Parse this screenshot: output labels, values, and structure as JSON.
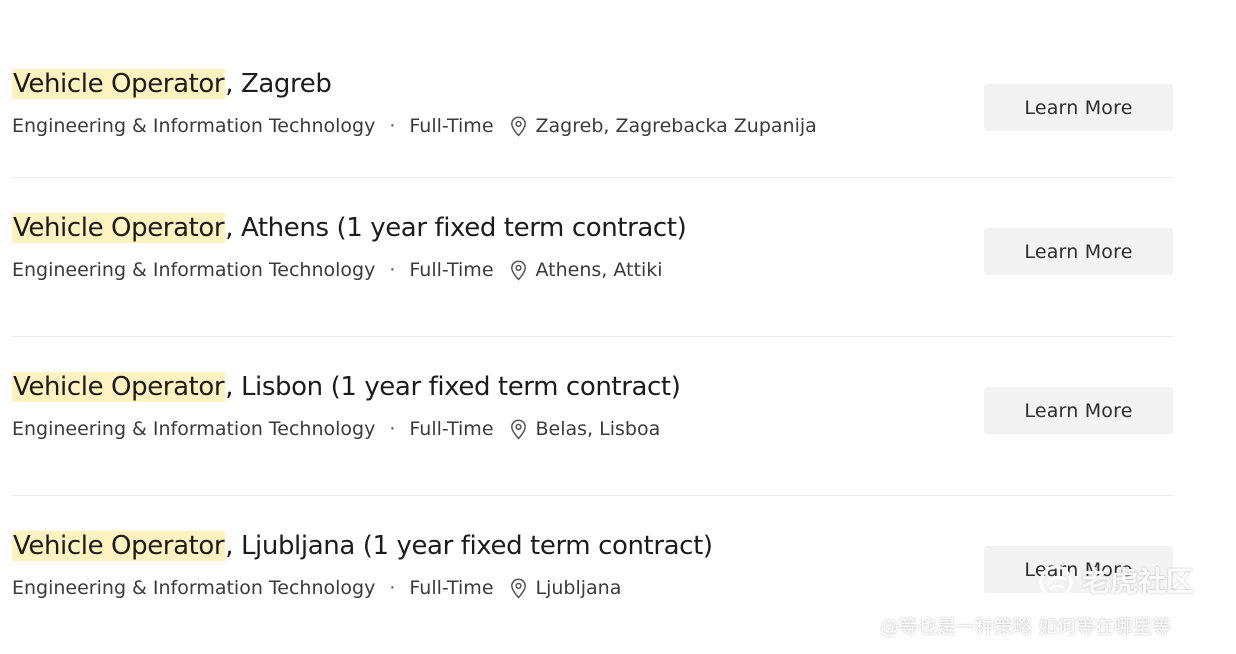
{
  "jobs": [
    {
      "title_highlight": "Vehicle Operator",
      "title_rest": ", Zagreb",
      "department": "Engineering & Information Technology",
      "separator": "·",
      "employment_type": "Full-Time",
      "location": "Zagreb, Zagrebacka Zupanija",
      "cta_label": "Learn More"
    },
    {
      "title_highlight": "Vehicle Operator",
      "title_rest": ", Athens (1 year fixed term contract)",
      "department": "Engineering & Information Technology",
      "separator": "·",
      "employment_type": "Full-Time",
      "location": "Athens, Attiki",
      "cta_label": "Learn More"
    },
    {
      "title_highlight": "Vehicle Operator",
      "title_rest": ", Lisbon (1 year fixed term contract)",
      "department": "Engineering & Information Technology",
      "separator": "·",
      "employment_type": "Full-Time",
      "location": "Belas, Lisboa",
      "cta_label": "Learn More"
    },
    {
      "title_highlight": "Vehicle Operator",
      "title_rest": ", Ljubljana (1 year fixed term contract)",
      "department": "Engineering & Information Technology",
      "separator": "·",
      "employment_type": "Full-Time",
      "location": "Ljubljana",
      "cta_label": "Learn More"
    }
  ],
  "icons": {
    "location": "map-pin-icon",
    "watermark": "tiger-logo-icon"
  },
  "colors": {
    "highlight": "#fdf2c0",
    "button_bg": "#f3f3f3",
    "divider": "#ececec"
  },
  "watermark": {
    "brand": "老虎社区",
    "caption": "@等也是一种策略 如何等在哪里等"
  }
}
